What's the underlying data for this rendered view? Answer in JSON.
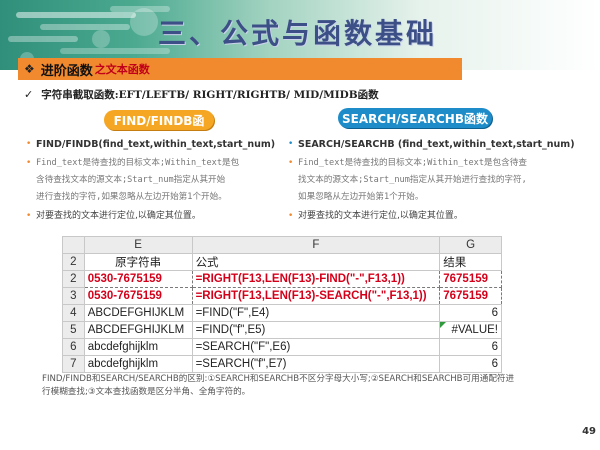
{
  "header": {
    "title": "三、公式与函数基础"
  },
  "section": {
    "bullet_icon": "diamond-bullet-icon",
    "title": "进阶函数",
    "subtitle": "之文本函数"
  },
  "subheading": {
    "check_icon": "check-icon",
    "text": "字符串截取函数:EFT/LEFTB/ RIGHT/RIGHTB/ MID/MIDB函数"
  },
  "badges": {
    "find": "FIND/FINDB函",
    "search": "SEARCH/SEARCHB函数"
  },
  "left_column": {
    "syntax": "FIND/FINDB(find_text,within_text,start_num)",
    "description_lines": [
      "Find_text是待查找的目标文本;Within_text是包",
      "含待查找文本的源文本;Start_num指定从其开始",
      "进行查找的字符,如果忽略从左边开始第1个开始。"
    ],
    "note": "对要查找的文本进行定位,以确定其位置。"
  },
  "right_column": {
    "syntax": "SEARCH/SEARCHB  (find_text,within_text,start_num)",
    "description_lines": [
      "Find_text是待查找的目标文本;Within_text是包含待查",
      "找文本的源文本;Start_num指定从其开始进行查找的字符,",
      "如果忽略从左边开始第1个开始。"
    ],
    "note": "对要查找的文本进行定位,以确定其位置。"
  },
  "sheet": {
    "columns": [
      "E",
      "F",
      "G"
    ],
    "rows": [
      {
        "n": "2",
        "e": "原字符串",
        "f": "公式",
        "g": "结果",
        "style": "header"
      },
      {
        "n": "2",
        "e": "0530-7675159",
        "f": "=RIGHT(F13,LEN(F13)-FIND(\"-\",F13,1))",
        "g": "7675159",
        "style": "red"
      },
      {
        "n": "3",
        "e": "0530-7675159",
        "f": "=RIGHT(F13,LEN(F13)-SEARCH(\"-\",F13,1))",
        "g": "7675159",
        "style": "red"
      },
      {
        "n": "4",
        "e": "ABCDEFGHIJKLM",
        "f": "=FIND(\"F\",E4)",
        "g": "6",
        "style": "plain"
      },
      {
        "n": "5",
        "e": "ABCDEFGHIJKLM",
        "f": "=FIND(\"f\",E5)",
        "g": "#VALUE!",
        "style": "error"
      },
      {
        "n": "6",
        "e": "abcdefghijklm",
        "f": "=SEARCH(\"F\",E6)",
        "g": "6",
        "style": "plain"
      },
      {
        "n": "7",
        "e": "abcdefghijklm",
        "f": "=SEARCH(\"f\",E7)",
        "g": "6",
        "style": "plain"
      }
    ]
  },
  "bottom_note": {
    "lines": [
      "FIND/FINDB和SEARCH/SEARCHB的区别:①SEARCH和SEARCHB不区分字母大小写;②SEARCH和SEARCHB可用通配符进",
      "行模糊查找;③文本查找函数是区分半角、全角字符的。"
    ]
  },
  "page_number": "49",
  "colors": {
    "accent_orange": "#f18a2e",
    "title_blue": "#3c4f86",
    "badge_orange": "#f5a623",
    "badge_blue": "#1d8cc8",
    "emphasis_red": "#d4001a"
  }
}
